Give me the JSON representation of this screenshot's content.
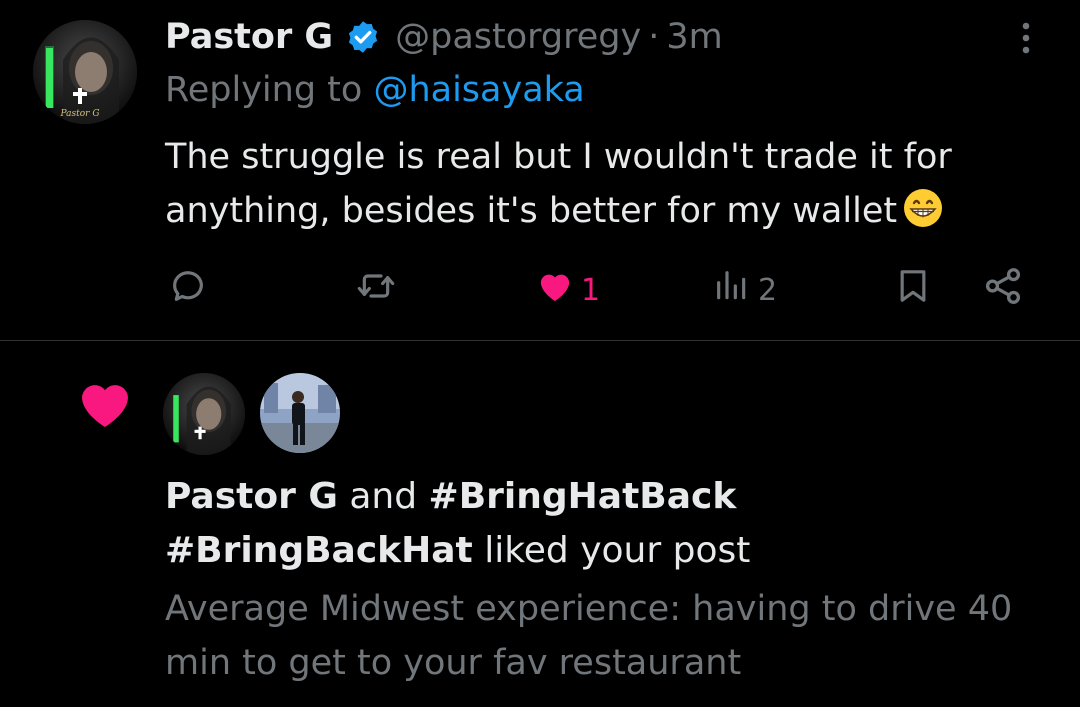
{
  "reply_tweet": {
    "display_name": "Pastor G",
    "handle": "@pastorgregy",
    "separator": "·",
    "time": "3m",
    "replying_prefix": "Replying to ",
    "replying_to": "@haisayaka",
    "text": "The struggle is real but I wouldn't trade it for anything, besides it's better for my wallet",
    "emoji": "grinning-face-emoji",
    "avatar_caption": "Pastor G",
    "actions": {
      "reply_count": "",
      "retweet_count": "",
      "like_count": "1",
      "view_count": "2"
    },
    "colors": {
      "verified": "#1d9bf0",
      "mention": "#1d9bf0",
      "like": "#f91880",
      "muted": "#71767b"
    }
  },
  "notification": {
    "icon": "heart-icon",
    "user1": "Pastor G",
    "conjunction": " and ",
    "user2_line1": "#BringHatBack",
    "user2_line2": "#BringBackHat",
    "action": " liked your post",
    "post_preview": "Average Midwest experience: having to drive 40 min to get to your fav restaurant"
  }
}
